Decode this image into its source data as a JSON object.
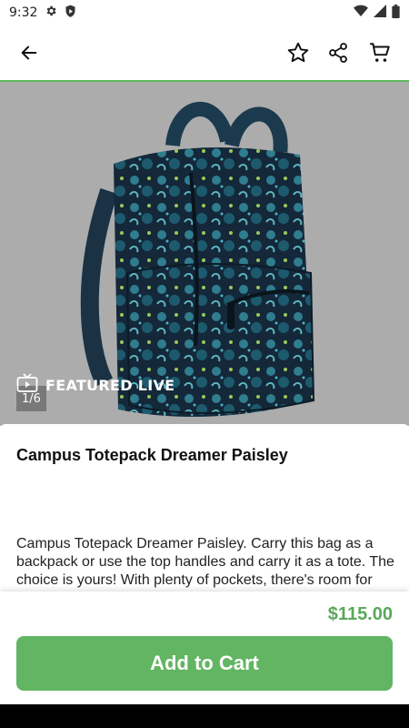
{
  "status_bar": {
    "time": "9:32",
    "icons": [
      "gear-icon",
      "shield-play-icon",
      "wifi-icon",
      "signal-icon",
      "battery-icon"
    ]
  },
  "app_bar": {
    "icons": [
      "back-arrow-icon",
      "star-icon",
      "share-icon",
      "cart-icon"
    ]
  },
  "hero": {
    "featured_label": "FEATURED LIVE",
    "image_counter": "1/6",
    "background": "#acacac"
  },
  "product": {
    "title": "Campus Totepack Dreamer Paisley",
    "description": "Campus Totepack Dreamer Paisley. Carry this bag as a backpack or use the top handles and carry it as a tote. The choice is yours! With plenty of pockets, there's room for everything."
  },
  "bottom": {
    "price": "$115.00",
    "add_to_cart_label": "Add to Cart"
  },
  "colors": {
    "accent": "#62b562",
    "price": "#5aa85a"
  }
}
